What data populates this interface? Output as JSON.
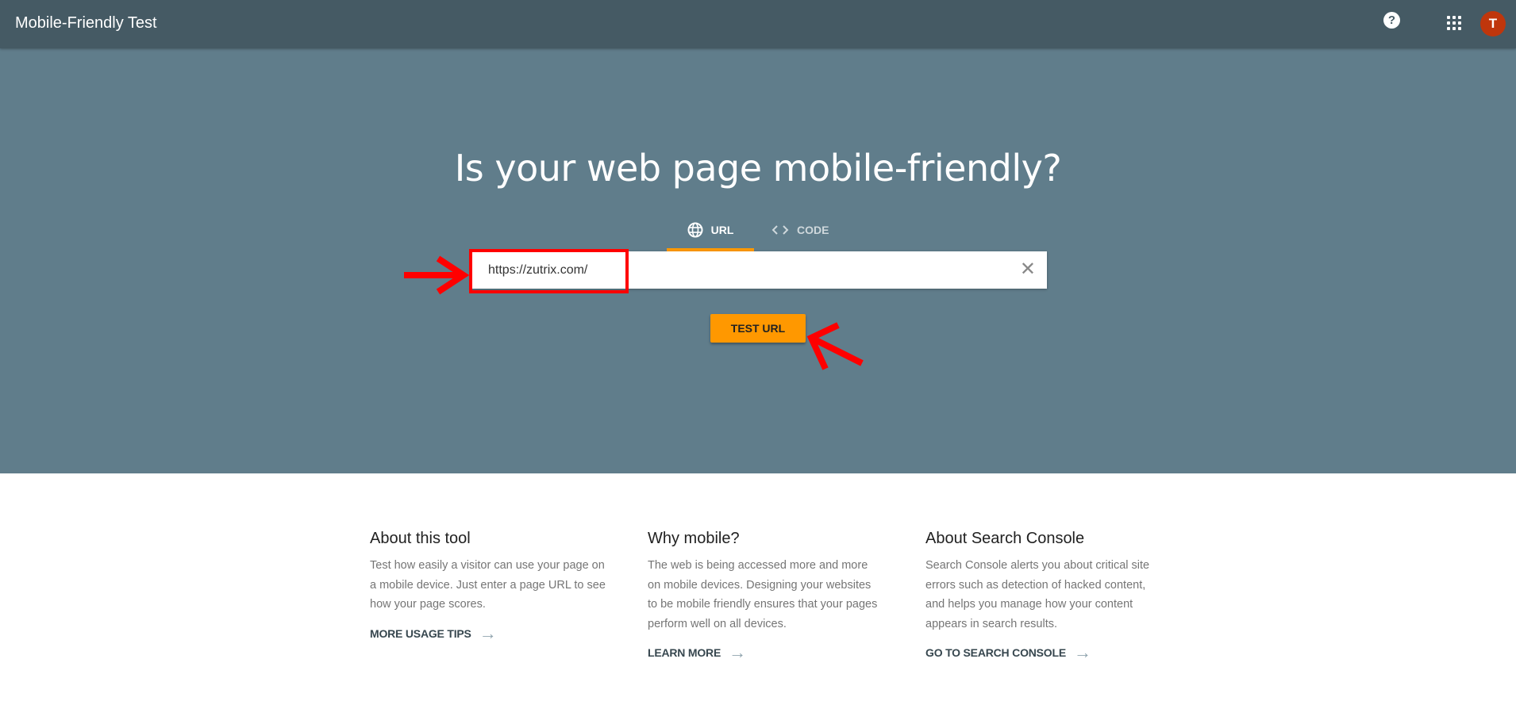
{
  "header": {
    "title": "Mobile-Friendly Test",
    "help_icon": "help-circle-icon",
    "apps_icon": "apps-grid-icon",
    "avatar_letter": "T",
    "avatar_color": "#bf360c"
  },
  "hero": {
    "headline": "Is your web page mobile-friendly?",
    "tabs": [
      {
        "label": "URL",
        "icon": "globe-icon",
        "active": true
      },
      {
        "label": "CODE",
        "icon": "code-icon",
        "active": false
      }
    ],
    "url_input": {
      "value": "https://zutrix.com/"
    },
    "test_button": "TEST URL",
    "accent": "#ff9800",
    "background": "#607d8b"
  },
  "info": [
    {
      "title": "About this tool",
      "body": "Test how easily a visitor can use your page on a mobile device. Just enter a page URL to see how your page scores.",
      "link": "MORE USAGE TIPS"
    },
    {
      "title": "Why mobile?",
      "body": "The web is being accessed more and more on mobile devices. Designing your websites to be mobile friendly ensures that your pages perform well on all devices.",
      "link": "LEARN MORE"
    },
    {
      "title": "About Search Console",
      "body": "Search Console alerts you about critical site errors such as detection of hacked content, and helps you manage how your content appears in search results.",
      "link": "GO TO SEARCH CONSOLE"
    }
  ]
}
